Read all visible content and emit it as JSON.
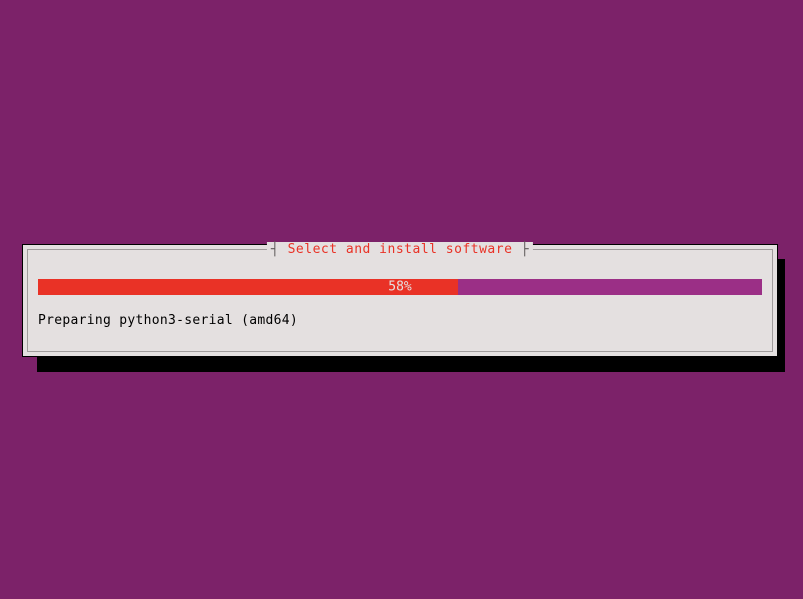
{
  "dialog": {
    "title": "Select and install software",
    "progress_percent": 58,
    "progress_label": "58%",
    "status": "Preparing python3-serial (amd64)"
  },
  "colors": {
    "background": "#7c2269",
    "panel": "#e4e0e0",
    "accent": "#e93226",
    "progress_bg": "#9b2f86"
  }
}
